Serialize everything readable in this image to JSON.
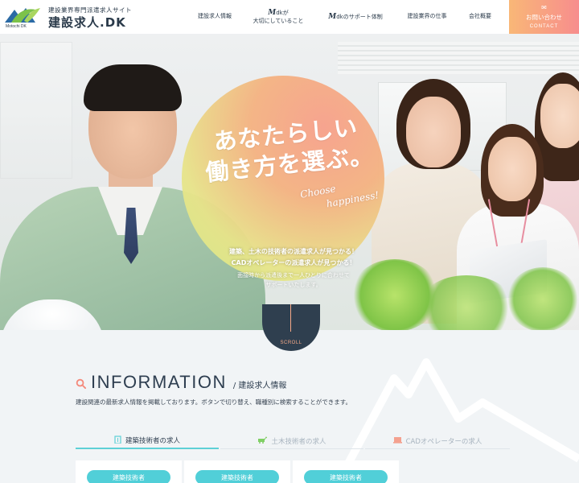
{
  "header": {
    "logo_wordmark": "Motochi DK",
    "logo_sub": "建設業界専門派遣求人サイト",
    "logo_main": "建設求人.DK",
    "nav": [
      {
        "label": "建設求人情報"
      },
      {
        "label_m": "M",
        "label_top": "dkが",
        "label_bottom": "大切にしていること"
      },
      {
        "label_m": "M",
        "label": "dkのサポート体制"
      },
      {
        "label": "建設業界の仕事"
      },
      {
        "label": "会社概要"
      }
    ],
    "contact": {
      "icon": "mail-icon",
      "label_jp": "お問い合わせ",
      "label_en": "CONTACT"
    },
    "colors": {
      "contact_from": "#f9b777",
      "contact_to": "#f78d8d",
      "text": "#2a3a4a"
    }
  },
  "hero": {
    "title_line1": "あなたらしい",
    "title_line2": "働き方を選ぶ。",
    "script_line1": "Choose",
    "script_line2": "happiness!",
    "copy_bold_1": "建築、土木の技術者の派遣求人が見つかる！",
    "copy_bold_2": "CADオペレーターの派遣求人が見つかる！",
    "copy_normal_1": "面接時から派遣後まで一人ひとりに合わせて",
    "copy_normal_2": "サポートいたします。",
    "scroll_label": "SCROLL"
  },
  "info": {
    "title": "INFORMATION",
    "subtitle": "/ 建設求人情報",
    "description": "建設関連の最新求人情報を掲載しております。ボタンで切り替え、職種別に検索することができます。",
    "tabs": [
      {
        "label": "建築技術者の求人",
        "icon": "building-icon",
        "active": true
      },
      {
        "label": "土木技術者の求人",
        "icon": "excavator-icon",
        "active": false
      },
      {
        "label": "CADオペレーターの求人",
        "icon": "laptop-icon",
        "active": false
      }
    ],
    "cards": [
      {
        "category": "建築技術者"
      },
      {
        "category": "建築技術者"
      },
      {
        "category": "建築技術者"
      }
    ],
    "colors": {
      "accent": "#51cfd8",
      "heading": "#2e3e50",
      "search_icon": "#f48a7c"
    }
  }
}
